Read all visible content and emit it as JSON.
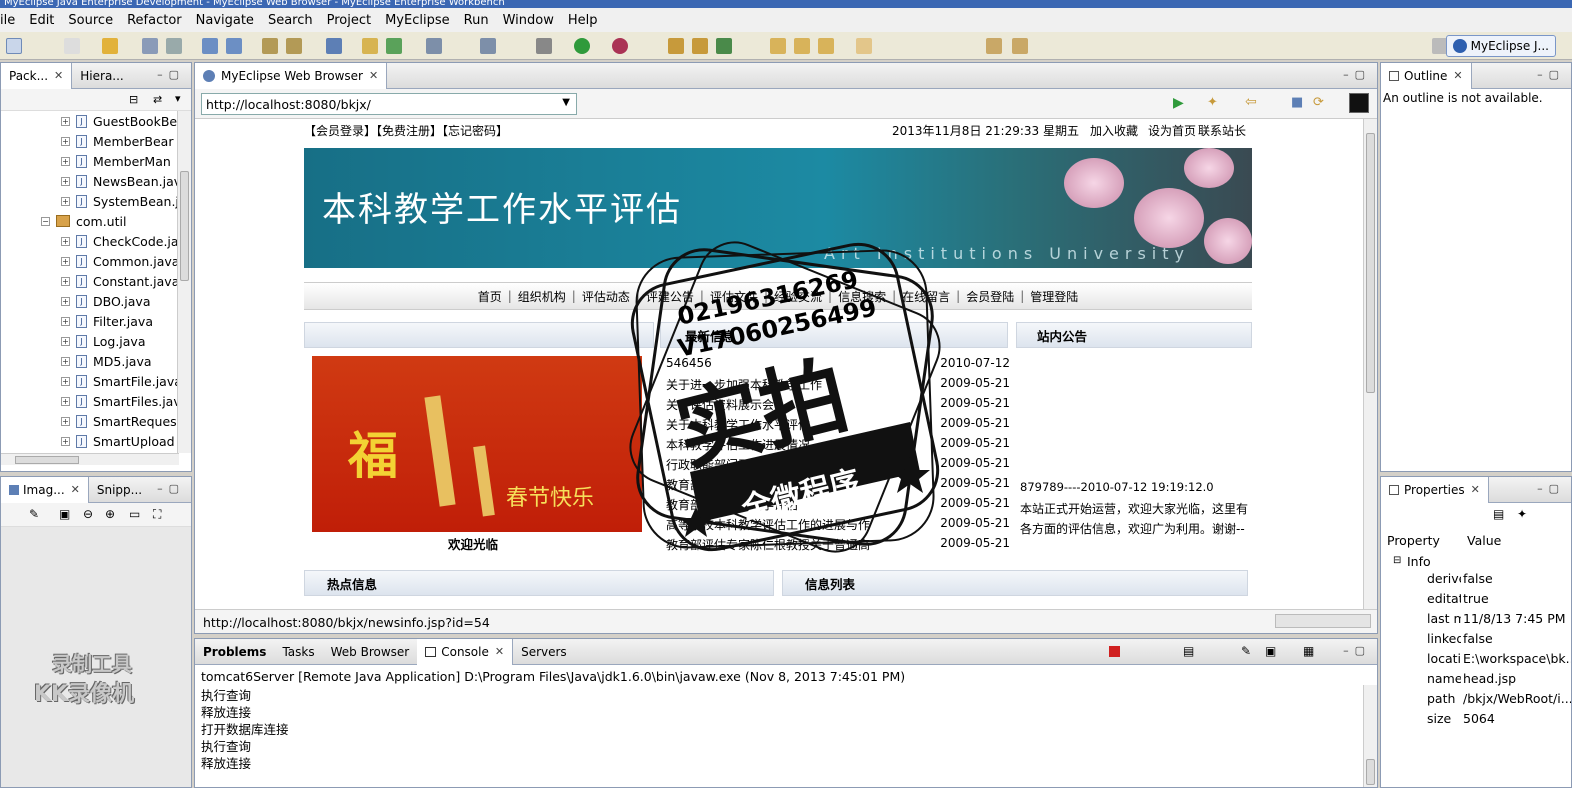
{
  "window": {
    "title": "MyEclipse Java Enterprise Development - MyEclipse Web Browser - MyEclipse Enterprise Workbench"
  },
  "menu": [
    "ile",
    "Edit",
    "Source",
    "Refactor",
    "Navigate",
    "Search",
    "Project",
    "MyEclipse",
    "Run",
    "Window",
    "Help"
  ],
  "perspective": {
    "label": "MyEclipse J..."
  },
  "left_top": {
    "tabs": [
      "Pack...",
      "Hiera..."
    ],
    "tree": [
      {
        "label": "GuestBookBe",
        "kind": "file"
      },
      {
        "label": "MemberBear",
        "kind": "file"
      },
      {
        "label": "MemberMan",
        "kind": "file"
      },
      {
        "label": "NewsBean.jav",
        "kind": "file"
      },
      {
        "label": "SystemBean.j",
        "kind": "file"
      },
      {
        "label": "com.util",
        "kind": "package"
      },
      {
        "label": "CheckCode.ja",
        "kind": "file"
      },
      {
        "label": "Common.java",
        "kind": "file"
      },
      {
        "label": "Constant.java",
        "kind": "file"
      },
      {
        "label": "DBO.java",
        "kind": "file"
      },
      {
        "label": "Filter.java",
        "kind": "file"
      },
      {
        "label": "Log.java",
        "kind": "file"
      },
      {
        "label": "MD5.java",
        "kind": "file"
      },
      {
        "label": "SmartFile.java",
        "kind": "file"
      },
      {
        "label": "SmartFiles.jav",
        "kind": "file"
      },
      {
        "label": "SmartReques",
        "kind": "file"
      },
      {
        "label": "SmartUpload",
        "kind": "file"
      }
    ]
  },
  "left_bottom": {
    "tabs": [
      "Imag...",
      "Snipp..."
    ]
  },
  "browser": {
    "tab": "MyEclipse Web Browser",
    "url": "http://localhost:8080/bkjx/",
    "status_url": "http://localhost:8080/bkjx/newsinfo.jsp?id=54"
  },
  "site": {
    "top_left": "【会员登录】【免费注册】【忘记密码】",
    "datetime": "2013年11月8日 21:29:33 星期五",
    "top_right": [
      "加入收藏",
      "设为首页",
      "联系站长"
    ],
    "banner_title": "本科教学工作水平评估",
    "banner_sub": "Art Institutions University",
    "nav": [
      "首页",
      "组织机构",
      "评估动态",
      "评建公告",
      "评估文件",
      "经验交流",
      "信息搜索",
      "在线留言",
      "会员登陆",
      "管理登陆"
    ],
    "latest_header": "最新信息",
    "notice_header": "站内公告",
    "latest": [
      {
        "title": "546456",
        "date": "2010-07-12"
      },
      {
        "title": "关于进一步加强本科教学工作",
        "date": "2009-05-21"
      },
      {
        "title": "关于评估资料展示会",
        "date": "2009-05-21"
      },
      {
        "title": "关于本科教学工作水平评估",
        "date": "2009-05-21"
      },
      {
        "title": "本科教学评估工作进展情况",
        "date": "2009-05-21"
      },
      {
        "title": "行政职能部门及系资料准备要求",
        "date": "2009-05-21"
      },
      {
        "title": "教育部关于印发评估方案",
        "date": "2009-05-21"
      },
      {
        "title": "教育部关于本科教学评估",
        "date": "2009-05-21"
      },
      {
        "title": "高等学校本科教学评估工作的进展与作",
        "date": "2009-05-21"
      },
      {
        "title": "教育部评估专家陈仁根教授关于普通高",
        "date": "2009-05-21"
      }
    ],
    "notice_item": "879789----2010-07-12 19:19:12.0",
    "notice_text_1": "本站正式开始运营，欢迎大家光临，这里有",
    "notice_text_2": "各方面的评估信息，欢迎广为利用。谢谢--",
    "fu_char": "福",
    "spring_text": "春节快乐",
    "welcome": "欢迎光临",
    "hot_header": "热点信息",
    "list_header": "信息列表"
  },
  "bottom": {
    "tabs": [
      "Problems",
      "Tasks",
      "Web Browser",
      "Console",
      "Servers"
    ],
    "console_title": "tomcat6Server [Remote Java Application] D:\\Program Files\\Java\\jdk1.6.0\\bin\\javaw.exe (Nov 8, 2013 7:45:01 PM)",
    "lines": [
      "执行查询",
      "释放连接",
      "打开数据库连接",
      "执行查询",
      "释放连接"
    ]
  },
  "outline": {
    "tab": "Outline",
    "message": "An outline is not available."
  },
  "properties": {
    "tab": "Properties",
    "col_property": "Property",
    "col_value": "Value",
    "group": "Info",
    "rows": [
      {
        "name": "derive",
        "value": "false"
      },
      {
        "name": "editat",
        "value": "true"
      },
      {
        "name": "last m",
        "value": "11/8/13 7:45 PM"
      },
      {
        "name": "linked",
        "value": "false"
      },
      {
        "name": "locatic",
        "value": "E:\\workspace\\bk..."
      },
      {
        "name": "name",
        "value": "head.jsp"
      },
      {
        "name": "path",
        "value": "/bkjx/WebRoot/i..."
      },
      {
        "name": "size",
        "value": "5064"
      }
    ]
  },
  "overlay": {
    "stamp_main": "实拍",
    "stamp_sub": "全微程序",
    "stamp_num1": "02196316269",
    "stamp_num2": "V17060256499",
    "watermark_1": "录制工具",
    "watermark_2": "KK录像机"
  },
  "colors": {
    "eclipse_bg": "#d4d0c8",
    "banner": "#1c8aa3",
    "fu_red": "#c01e08"
  }
}
